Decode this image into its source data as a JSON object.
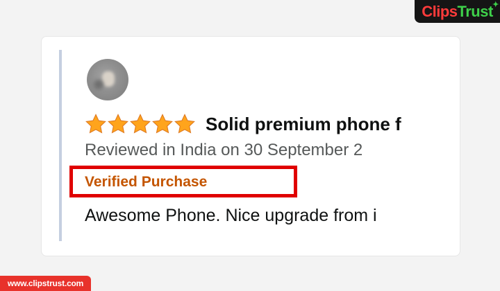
{
  "brand": {
    "part1": "Clips",
    "part2": "Trust",
    "url": "www.clipstrust.com",
    "colors": {
      "clips": "#ff3b3b",
      "trust": "#3ed14a",
      "badge_bg": "#151515",
      "url_bg": "#e8322b"
    }
  },
  "review": {
    "avatar_icon": "user-avatar",
    "rating": 5,
    "rating_max": 5,
    "star_color": "#ffa41c",
    "title": "Solid premium phone f",
    "meta": "Reviewed in India on 30 September 2",
    "verified_label": "Verified Purchase",
    "verified_color": "#c45500",
    "highlight_color": "#e00000",
    "body": "Awesome Phone. Nice upgrade from i"
  }
}
